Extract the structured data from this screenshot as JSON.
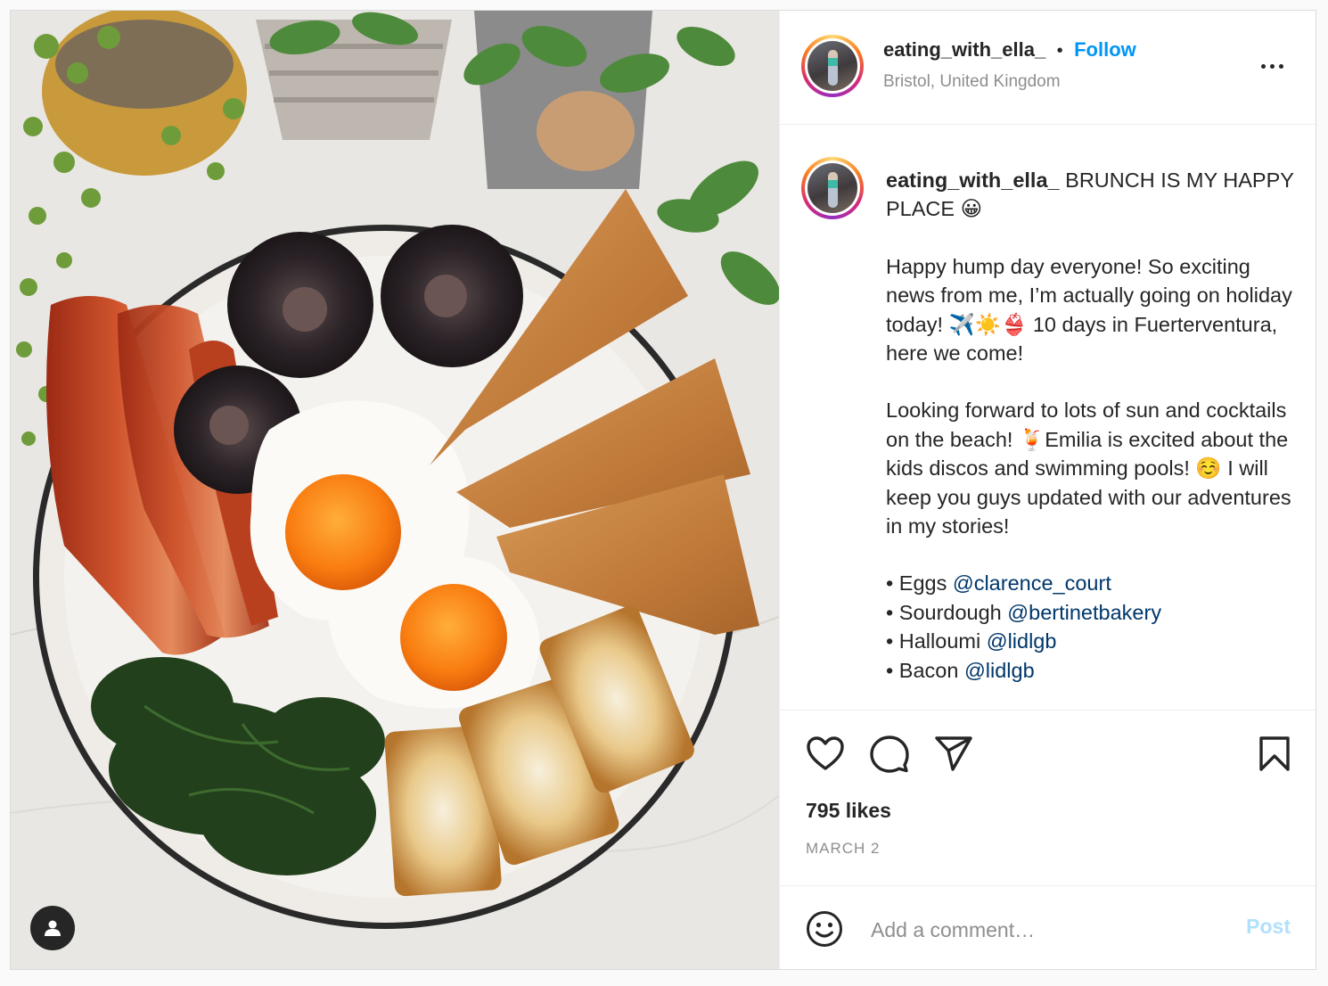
{
  "post": {
    "username": "eating_with_ella_",
    "follow_label": "Follow",
    "separator": "•",
    "location": "Bristol, United Kingdom",
    "caption": {
      "username": "eating_with_ella_",
      "headline": " BRUNCH IS MY HAPPY PLACE 😀",
      "para1": "Happy hump day everyone! So exciting news from me, I’m actually going on holiday today! ✈️☀️👙 10 days in Fuerterventura, here we come!",
      "para2": "Looking forward to lots of sun and cocktails on the beach! 🍹Emilia is excited about the kids discos and swimming pools! ☺️ I will keep you guys updated with our adventures in my stories!",
      "credits": [
        {
          "bullet": "• ",
          "item": "Eggs ",
          "mention": "@clarence_court"
        },
        {
          "bullet": "• ",
          "item": "Sourdough ",
          "mention": "@bertinetbakery"
        },
        {
          "bullet": "• ",
          "item": "Halloumi ",
          "mention": "@lidlgb"
        },
        {
          "bullet": "• ",
          "item": "Bacon ",
          "mention": "@lidlgb"
        }
      ]
    },
    "likes": "795 likes",
    "date": "MARCH 2",
    "comment": {
      "placeholder": "Add a comment…",
      "post_label": "Post"
    }
  },
  "icons": {
    "tag": "user-tag-icon",
    "more": "more-options-icon",
    "like": "heart-icon",
    "comment": "comment-bubble-icon",
    "share": "paper-plane-icon",
    "save": "bookmark-icon",
    "emoji": "smiley-emoji-icon"
  },
  "colors": {
    "follow": "#0095f6",
    "mention": "#00376b",
    "post_disabled": "#b2dffc",
    "secondary_text": "#8e8e8e"
  }
}
